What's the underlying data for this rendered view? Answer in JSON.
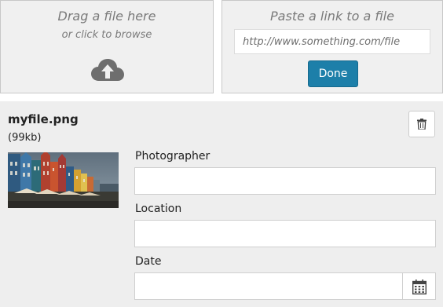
{
  "upload": {
    "drag_title": "Drag a file here",
    "drag_subtitle": "or click to browse",
    "upload_icon": "cloud-upload-icon",
    "link_title": "Paste a link to a file",
    "link_placeholder": "http://www.something.com/file",
    "link_value": "",
    "done_label": "Done"
  },
  "file": {
    "name": "myfile.png",
    "size": "(99kb)",
    "delete_icon": "trash-icon",
    "thumbnail_description_icon": "image-thumbnail"
  },
  "fields": {
    "photographer_label": "Photographer",
    "photographer_value": "",
    "location_label": "Location",
    "location_value": "",
    "date_label": "Date",
    "date_value": "",
    "calendar_icon": "calendar-icon"
  },
  "colors": {
    "accent": "#1d7fa9",
    "panel_bg": "#f0f0f0",
    "details_bg": "#eeeeee"
  }
}
